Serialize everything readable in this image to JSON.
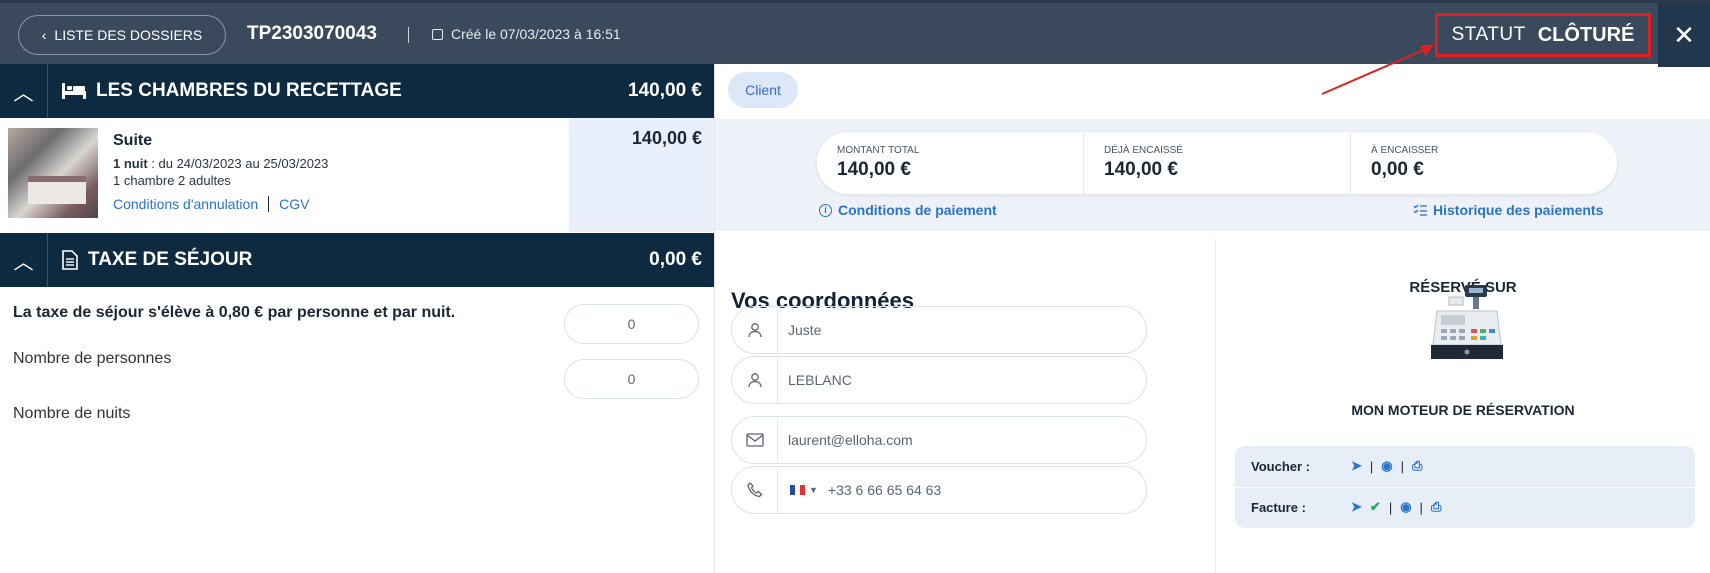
{
  "header": {
    "back_label": "LISTE DES DOSSIERS",
    "file_id": "TP2303070043",
    "created_label": "Créé le 07/03/2023 à 16:51",
    "status_label": "STATUT",
    "status_value": "CLÔTURÉ",
    "close_icon": "close-icon"
  },
  "rooms_section": {
    "title": "LES CHAMBRES DU RECETTAGE",
    "total": "140,00 €",
    "room": {
      "name": "Suite",
      "nights_bold": "1 nuit",
      "dates": " : du 24/03/2023 au 25/03/2023",
      "occupancy": "1 chambre 2 adultes",
      "cancel_link": "Conditions d'annulation",
      "cgv_link": "CGV",
      "price": "140,00 €"
    }
  },
  "tax_section": {
    "title": "TAXE DE SÉJOUR",
    "total": "0,00 €",
    "description": "La taxe de séjour s'élève à 0,80 € par personne et par nuit.",
    "persons_label": "Nombre de personnes",
    "persons_value": "0",
    "nights_label": "Nombre de nuits",
    "nights_value": "0"
  },
  "right": {
    "client_tab": "Client",
    "payment": {
      "total_label": "MONTANT TOTAL",
      "total_value": "140,00 €",
      "collected_label": "DÉJÀ ENCAISSÉ",
      "collected_value": "140,00 €",
      "to_collect_label": "À ENCAISSER",
      "to_collect_value": "0,00 €",
      "conditions_link": "Conditions de paiement",
      "history_link": "Historique des paiements"
    },
    "contact": {
      "title": "Vos coordonnées",
      "first_name": "Juste",
      "last_name": "LEBLANC",
      "email": "laurent@elloha.com",
      "phone": "+33 6 66 65 64 63"
    },
    "booking_source": {
      "title": "RÉSERVÉ SUR",
      "engine": "MON MOTEUR DE RÉSERVATION"
    },
    "documents": {
      "voucher_label": "Voucher :",
      "invoice_label": "Facture :"
    }
  },
  "colors": {
    "header_bg": "#3a4a5c",
    "section_bg": "#0d2a40",
    "accent": "#2a73c8",
    "status_border": "#e02020"
  }
}
